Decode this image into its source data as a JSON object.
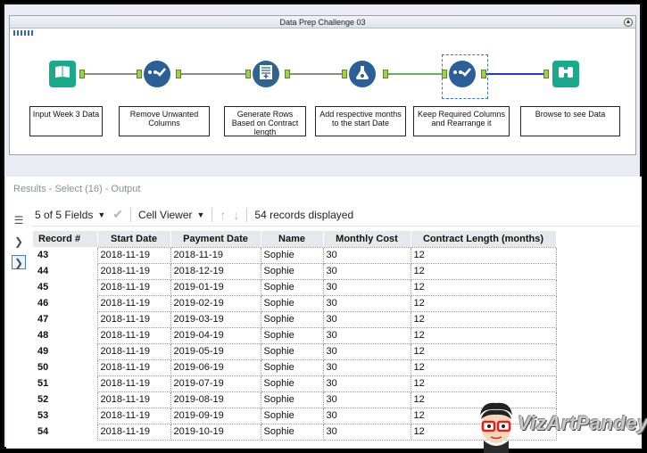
{
  "workflow": {
    "title": "Data Prep Challenge 03",
    "tools": [
      {
        "name": "input-data-tool",
        "icon": "book-icon",
        "label": "Input Week 3 Data",
        "color": "#1aa98a"
      },
      {
        "name": "select-tool-1",
        "icon": "checkmark-select-icon",
        "label": "Remove Unwanted Columns",
        "color": "#2b6aa3"
      },
      {
        "name": "generate-rows-tool",
        "icon": "generate-rows-icon",
        "label": "Generate Rows Based on Contract length",
        "color": "#2f6e9e"
      },
      {
        "name": "formula-tool",
        "icon": "flask-icon",
        "label": "Add respective months to the start Date",
        "color": "#2b6aa3"
      },
      {
        "name": "select-tool-2",
        "icon": "checkmark-select-icon",
        "label": "Keep Required Columns and Rearrange it",
        "color": "#2b6aa3"
      },
      {
        "name": "browse-tool",
        "icon": "binoculars-icon",
        "label": "Browse to see Data",
        "color": "#1aa98a"
      }
    ]
  },
  "results": {
    "title": "Results - Select (16) - Output",
    "fields_label": "5 of 5 Fields",
    "viewer_label": "Cell Viewer",
    "records_label": "54 records displayed",
    "columns": [
      "Record #",
      "Start Date",
      "Payment Date",
      "Name",
      "Monthly Cost",
      "Contract Length (months)"
    ],
    "rows": [
      [
        "43",
        "2018-11-19",
        "2018-11-19",
        "Sophie",
        "30",
        "12"
      ],
      [
        "44",
        "2018-11-19",
        "2018-12-19",
        "Sophie",
        "30",
        "12"
      ],
      [
        "45",
        "2018-11-19",
        "2019-01-19",
        "Sophie",
        "30",
        "12"
      ],
      [
        "46",
        "2018-11-19",
        "2019-02-19",
        "Sophie",
        "30",
        "12"
      ],
      [
        "47",
        "2018-11-19",
        "2019-03-19",
        "Sophie",
        "30",
        "12"
      ],
      [
        "48",
        "2018-11-19",
        "2019-04-19",
        "Sophie",
        "30",
        "12"
      ],
      [
        "49",
        "2018-11-19",
        "2019-05-19",
        "Sophie",
        "30",
        "12"
      ],
      [
        "50",
        "2018-11-19",
        "2019-06-19",
        "Sophie",
        "30",
        "12"
      ],
      [
        "51",
        "2018-11-19",
        "2019-07-19",
        "Sophie",
        "30",
        "12"
      ],
      [
        "52",
        "2018-11-19",
        "2019-08-19",
        "Sophie",
        "30",
        "12"
      ],
      [
        "53",
        "2018-11-19",
        "2019-09-19",
        "Sophie",
        "30",
        "12"
      ],
      [
        "54",
        "2018-11-19",
        "2019-10-19",
        "Sophie",
        "30",
        "12"
      ]
    ]
  },
  "badge": {
    "text": "VizArtPandey"
  }
}
